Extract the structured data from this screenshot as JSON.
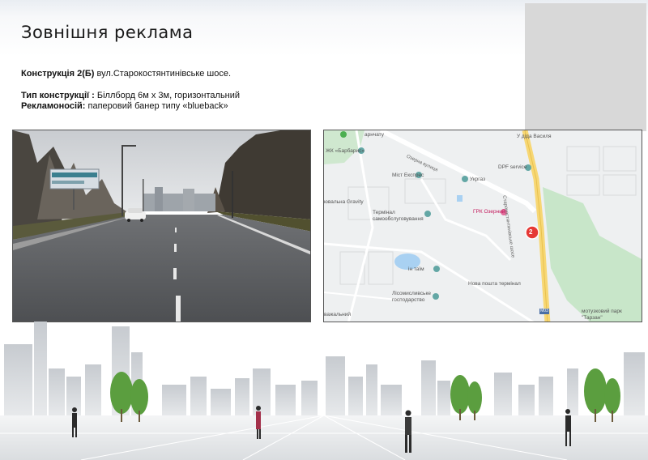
{
  "title": "Зовнішня реклама",
  "info": {
    "construction_label": "Конструкція 2(Б)",
    "construction_address": " вул.Старокостянтинівське шосе.",
    "type_label": "Тип конструкції :",
    "type_value": " Біллборд 6м х 3м, горизонтальний",
    "carrier_label": "Рекламоносій:",
    "carrier_value": " паперовий банер типу «blueback»"
  },
  "map": {
    "labels": {
      "barbaris": "ЖК «Барбарис»",
      "zarnytsia": "арнчату",
      "ozerna": "Озерна вулиця",
      "misto_ekspres": "Міст Експрес",
      "ukrgaz": "Укргаз",
      "dpf": "DPF service",
      "u_dida": "У діда Василя",
      "starokost": "Старокостянтинівське шосе",
      "gravity": "ювальна Gravity",
      "terminal": "Термінал самообслуговування",
      "grk": "ГРК Озерний",
      "in_taim": "ін таїм",
      "nova_poshta": "Нова пошта термінал",
      "lisomysl": "Лісомисливське господарство",
      "vazhalnyi": "важальний",
      "park": "мотузковий парк \"Тарзан\"",
      "road_num": "М03",
      "marker": "2"
    }
  }
}
